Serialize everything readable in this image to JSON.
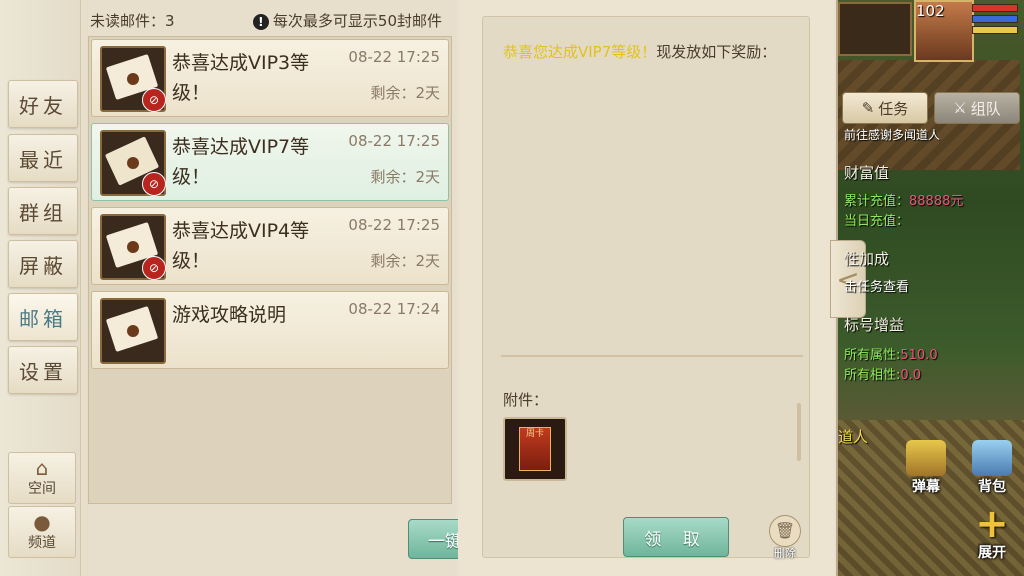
{
  "sidebar": {
    "tabs": [
      {
        "label": "好友"
      },
      {
        "label": "最近"
      },
      {
        "label": "群组"
      },
      {
        "label": "屏蔽"
      },
      {
        "label": "邮箱"
      },
      {
        "label": "设置"
      }
    ],
    "space_label": "空间",
    "channel_label": "频道"
  },
  "mail_list": {
    "unread_text": "未读邮件：3",
    "notice_text": "每次最多可显示50封邮件",
    "items": [
      {
        "title": "恭喜达成VIP3等级！",
        "date": "08-22 17:25",
        "remaining": "剩余：2天"
      },
      {
        "title": "恭喜达成VIP7等级！",
        "date": "08-22 17:25",
        "remaining": "剩余：2天"
      },
      {
        "title": "恭喜达成VIP4等级！",
        "date": "08-22 17:25",
        "remaining": "剩余：2天"
      },
      {
        "title": "游戏攻略说明",
        "date": "08-22 17:24",
        "remaining": ""
      }
    ],
    "claim_all_label": "一键领取"
  },
  "detail": {
    "highlight_text": "恭喜您达成VIP7等级！",
    "body_text": "现发放如下奖励：",
    "attachment_label": "附件：",
    "attachment_card_text": "周卡",
    "receive_label": "领 取",
    "delete_label": "删除"
  },
  "hud": {
    "level": "102",
    "task_label": "任务",
    "team_label": "组队",
    "quest_hint": "前往感谢多闻道人",
    "wealth_title": "财富值",
    "total_recharge": "累计充值：",
    "total_recharge_value": "88888元",
    "today_recharge": "当日充值：",
    "attr_bonus_title": "性加成",
    "task_check": "击任务查看",
    "title_bonus": "标号增益",
    "all_attr": "所有属性:",
    "all_attr_value": "510.0",
    "all_affinity": "所有相性:",
    "all_affinity_value": "0.0",
    "npc_name": "道人",
    "barrage_label": "弹幕",
    "bag_label": "背包",
    "expand_label": "展开"
  },
  "colors": {
    "accent_button": "#6fb59c",
    "highlight_text": "#e2c21a",
    "notification_red": "#b8241e"
  }
}
